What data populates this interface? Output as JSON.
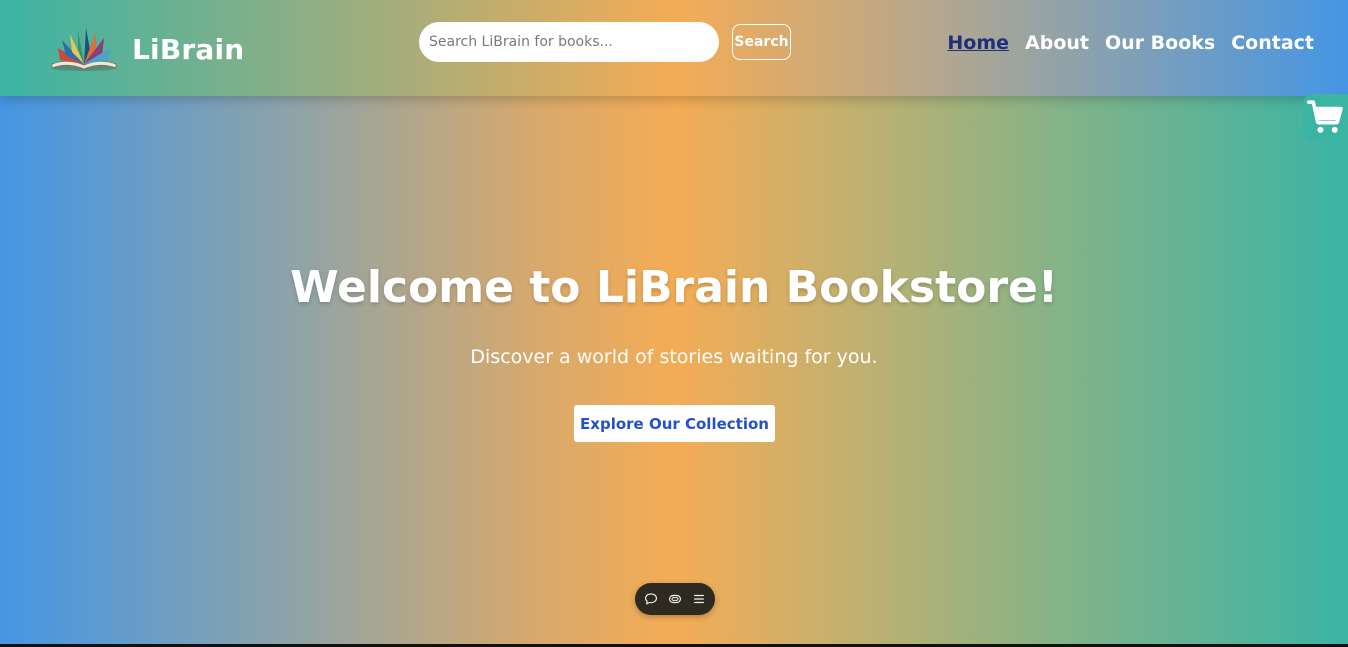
{
  "brand": {
    "name": "LiBrain",
    "logo_icon": "open-book-icon"
  },
  "search": {
    "placeholder": "Search LiBrain for books...",
    "value": "",
    "button_label": "Search"
  },
  "nav": {
    "items": [
      {
        "label": "Home",
        "active": true
      },
      {
        "label": "About",
        "active": false
      },
      {
        "label": "Our Books",
        "active": false
      },
      {
        "label": "Contact",
        "active": false
      }
    ]
  },
  "cart": {
    "icon": "cart-icon"
  },
  "hero": {
    "title": "Welcome to LiBrain Bookstore!",
    "subtitle": "Discover a world of stories waiting for you.",
    "cta_label": "Explore Our Collection"
  },
  "floating_toolbar": {
    "icons": [
      "chat-icon",
      "link-icon",
      "menu-icon"
    ]
  },
  "colors": {
    "accent_teal": "#3bb4a4",
    "accent_orange": "#f4ac55",
    "accent_blue": "#4596e4",
    "active_nav": "#1f2f7a",
    "cta_text": "#2451c7"
  }
}
